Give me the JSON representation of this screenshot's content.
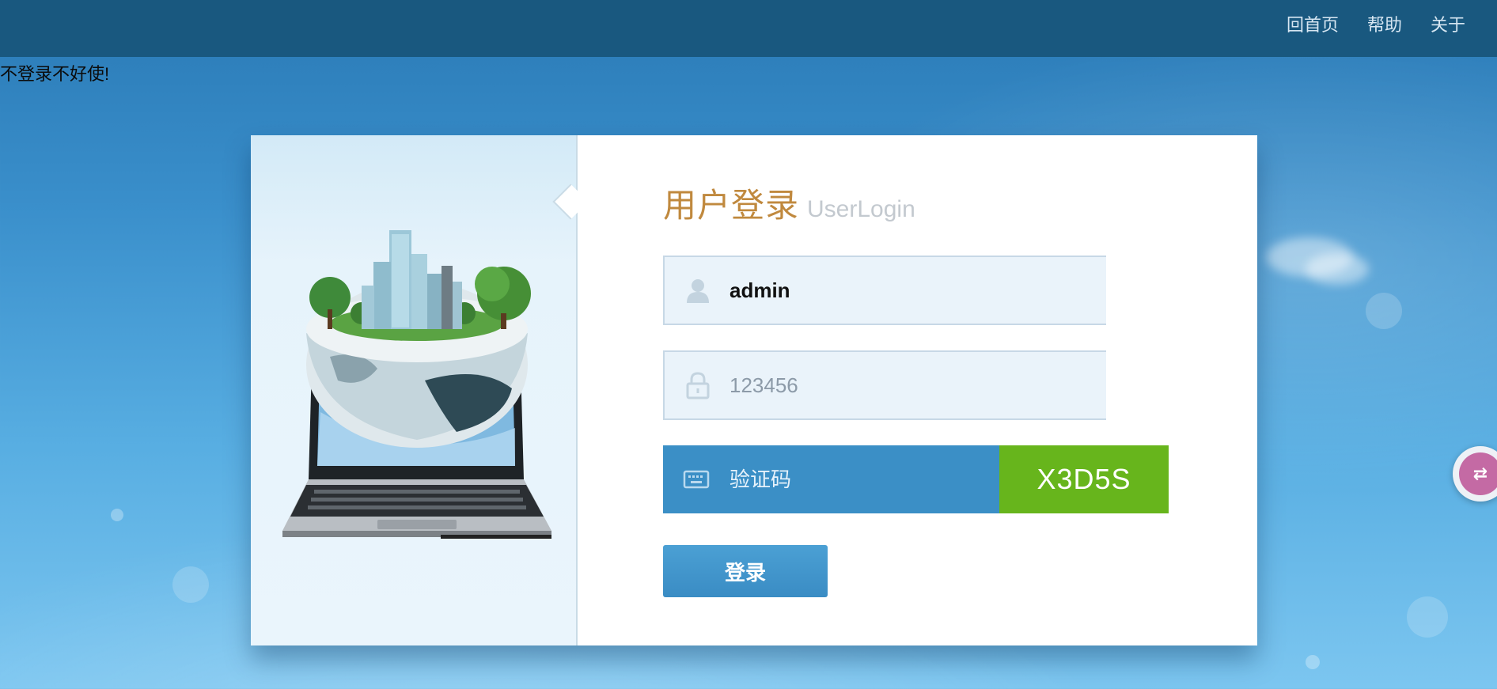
{
  "topnav": {
    "home": "回首页",
    "help": "帮助",
    "about": "关于"
  },
  "notice": "不登录不好使!",
  "login": {
    "title_cn": "用户登录",
    "title_en": "UserLogin",
    "username_value": "admin",
    "password_placeholder": "123456",
    "captcha_placeholder": "验证码",
    "captcha_code": "X3D5S",
    "submit_label": "登录"
  },
  "icons": {
    "user": "user-icon",
    "password": "lock-icon",
    "captcha": "keyboard-icon",
    "translate": "translate-icon"
  },
  "colors": {
    "topbar": "#19587f",
    "title": "#c0893e",
    "captcha_input": "#3b8fc6",
    "captcha_code": "#67b51c",
    "button": "#3a8cc4"
  }
}
